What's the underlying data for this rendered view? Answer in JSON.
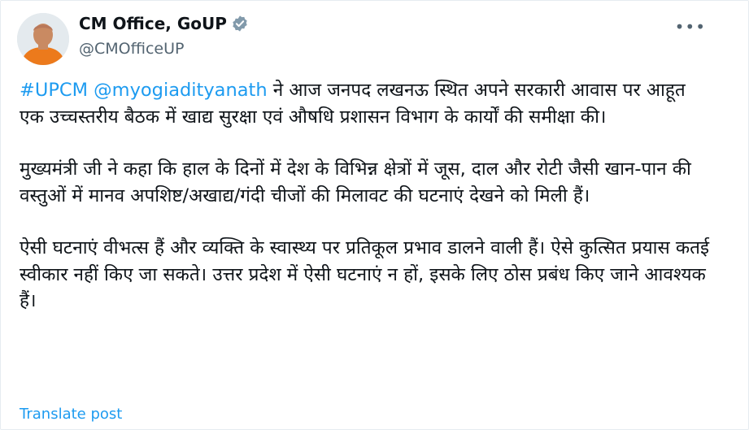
{
  "author": {
    "name": "CM Office, GoUP",
    "handle": "@CMOfficeUP",
    "verified": true
  },
  "tweet": {
    "hashtag": "#UPCM",
    "mention": "@myogiadityanath",
    "p1_rest": " ने आज जनपद लखनऊ स्थित अपने सरकारी आवास पर आहूत एक उच्चस्तरीय बैठक में खाद्य सुरक्षा एवं औषधि प्रशासन विभाग के कार्यों की समीक्षा की।",
    "p2": "मुख्यमंत्री जी ने कहा कि हाल के दिनों में देश के विभिन्न क्षेत्रों में जूस, दाल और रोटी जैसी खान-पान की वस्तुओं में मानव अपशिष्ट/अखाद्य/गंदी चीजों की मिलावट की घटनाएं देखने को मिली हैं।",
    "p3": "ऐसी घटनाएं वीभत्स हैं और व्यक्ति के स्वास्थ्य पर प्रतिकूल प्रभाव डालने वाली हैं। ऐसे कुत्सित प्रयास कतई स्वीकार नहीं किए जा सकते। उत्तर प्रदेश में ऐसी घटनाएं न हों, इसके लिए ठोस प्रबंध किए जाने आवश्यक हैं।"
  },
  "actions": {
    "more": "•••",
    "translate": "Translate post"
  },
  "colors": {
    "link": "#1d9bf0",
    "verified_badge": "#829aab",
    "text": "#0f1419",
    "secondary": "#536471"
  },
  "icons": [
    "avatar",
    "verified-badge-icon",
    "more-options-icon"
  ]
}
